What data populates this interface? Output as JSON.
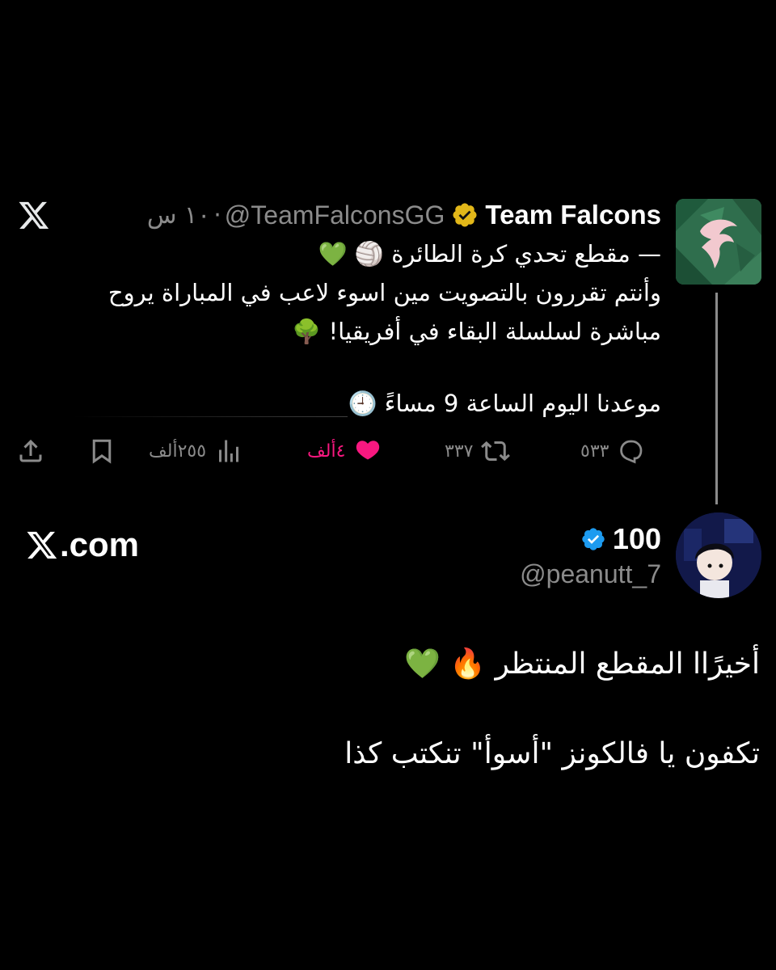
{
  "quoted_tweet": {
    "display_name": "Team Falcons",
    "handle": "@TeamFalconsGG",
    "time": "١٠ س",
    "separator": "·",
    "lines": [
      "— مقطع تحدي كرة الطائرة 🏐 💚",
      "وأنتم تقررون بالتصويت مين اسوء لاعب في المباراة يروح",
      "مباشرة لسلسلة البقاء في أفريقيا! 🌳",
      "",
      "موعدنا اليوم الساعة 9 مساءً 🕘"
    ],
    "stats": {
      "replies": "٥٣٣",
      "reposts": "٣٣٧",
      "likes": "٤ألف",
      "views": "٢٥٥ألف"
    },
    "colors": {
      "like": "#f91880",
      "muted": "#8b8b8b",
      "verified_gold": "#e2b719",
      "verified_blue": "#1d9bf0"
    }
  },
  "brand": {
    "xcom": ".com"
  },
  "reply": {
    "display_name": "100",
    "handle": "@peanutt_7",
    "line1": "أخيرًاا المقطع المنتظر 🔥 💚",
    "line2": "تكفون يا فالكونز  \"أسوأ\" تنكتب كذا"
  }
}
